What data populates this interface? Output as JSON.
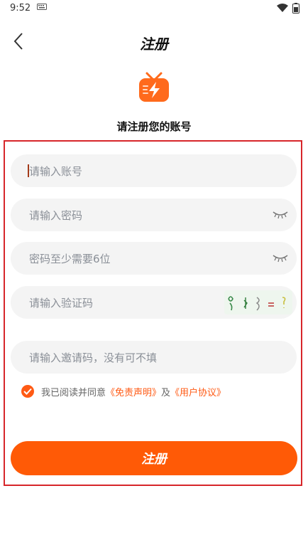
{
  "status_bar": {
    "time": "9:52"
  },
  "header": {
    "title": "注册"
  },
  "subtitle": "请注册您的账号",
  "fields": {
    "account": {
      "placeholder": "请输入账号",
      "value": ""
    },
    "password": {
      "placeholder": "请输入密码",
      "value": ""
    },
    "confirm_password": {
      "placeholder": "密码至少需要6位",
      "value": ""
    },
    "captcha": {
      "placeholder": "请输入验证码",
      "value": ""
    },
    "invite": {
      "placeholder": "请输入邀请码，没有可不填",
      "value": ""
    }
  },
  "agreement": {
    "checked": true,
    "prefix": "我已阅读并同意",
    "disclaimer_link": "《免责声明》",
    "and": "及",
    "user_agreement_link": "《用户协议》"
  },
  "submit_label": "注册",
  "colors": {
    "accent": "#ff5a06",
    "highlight_border": "#d7262a",
    "field_bg": "#f4f4f4"
  },
  "icons": [
    "keyboard-icon",
    "wifi-icon",
    "battery-icon",
    "back-arrow-icon",
    "tv-lightning-logo-icon",
    "eye-closed-icon",
    "checkmark-icon"
  ]
}
